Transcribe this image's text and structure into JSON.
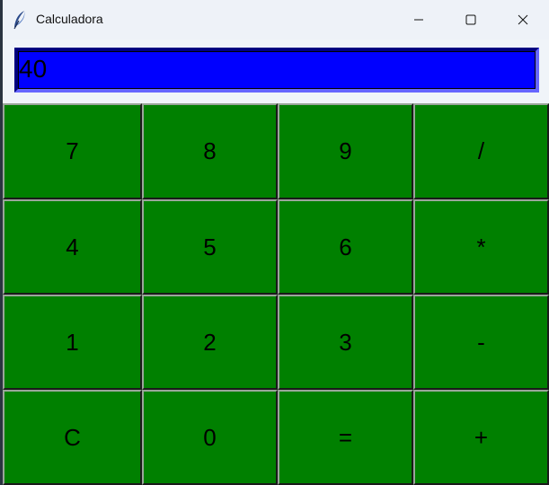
{
  "window": {
    "title": "Calculadora",
    "icon": "feather-icon",
    "controls": [
      "minimize-icon",
      "maximize-icon",
      "close-icon"
    ]
  },
  "display": {
    "value": "40"
  },
  "colors": {
    "button_bg": "#008000",
    "display_bg": "#0000ff",
    "window_bg": "#f0f4f9"
  },
  "keys": [
    [
      "7",
      "8",
      "9",
      "/"
    ],
    [
      "4",
      "5",
      "6",
      "*"
    ],
    [
      "1",
      "2",
      "3",
      "-"
    ],
    [
      "C",
      "0",
      "=",
      "+"
    ]
  ]
}
